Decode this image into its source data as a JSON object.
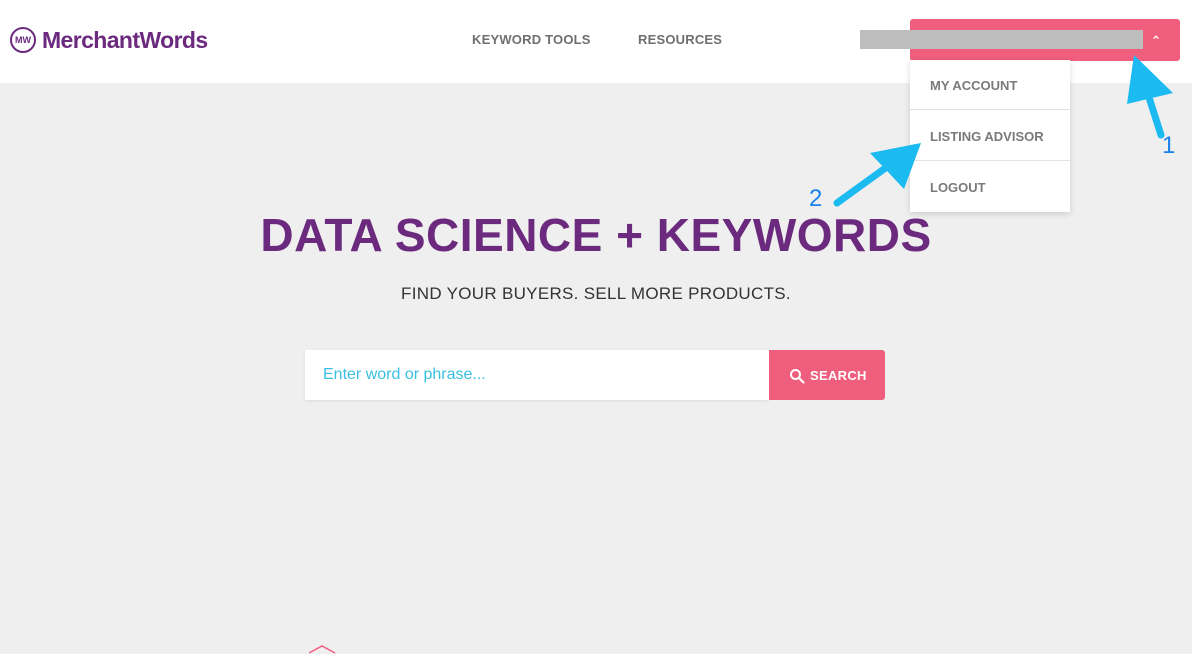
{
  "header": {
    "logo_text": "MerchantWords",
    "logo_mark": "MW",
    "nav": [
      {
        "label": "KEYWORD TOOLS"
      },
      {
        "label": "RESOURCES"
      }
    ],
    "account_chevron": "chevron-up-icon"
  },
  "dropdown": {
    "items": [
      {
        "label": "MY ACCOUNT"
      },
      {
        "label": "LISTING ADVISOR"
      },
      {
        "label": "LOGOUT"
      }
    ]
  },
  "hero": {
    "title": "DATA SCIENCE + KEYWORDS",
    "subtitle": "FIND YOUR BUYERS. SELL MORE PRODUCTS."
  },
  "search": {
    "placeholder": "Enter word or phrase...",
    "button_label": "SEARCH"
  },
  "annotations": {
    "arrow_1_label": "1",
    "arrow_2_label": "2"
  },
  "colors": {
    "brand_purple": "#6b2a7e",
    "accent_pink": "#f05e7d",
    "annotation_blue": "#1bbaf0"
  }
}
